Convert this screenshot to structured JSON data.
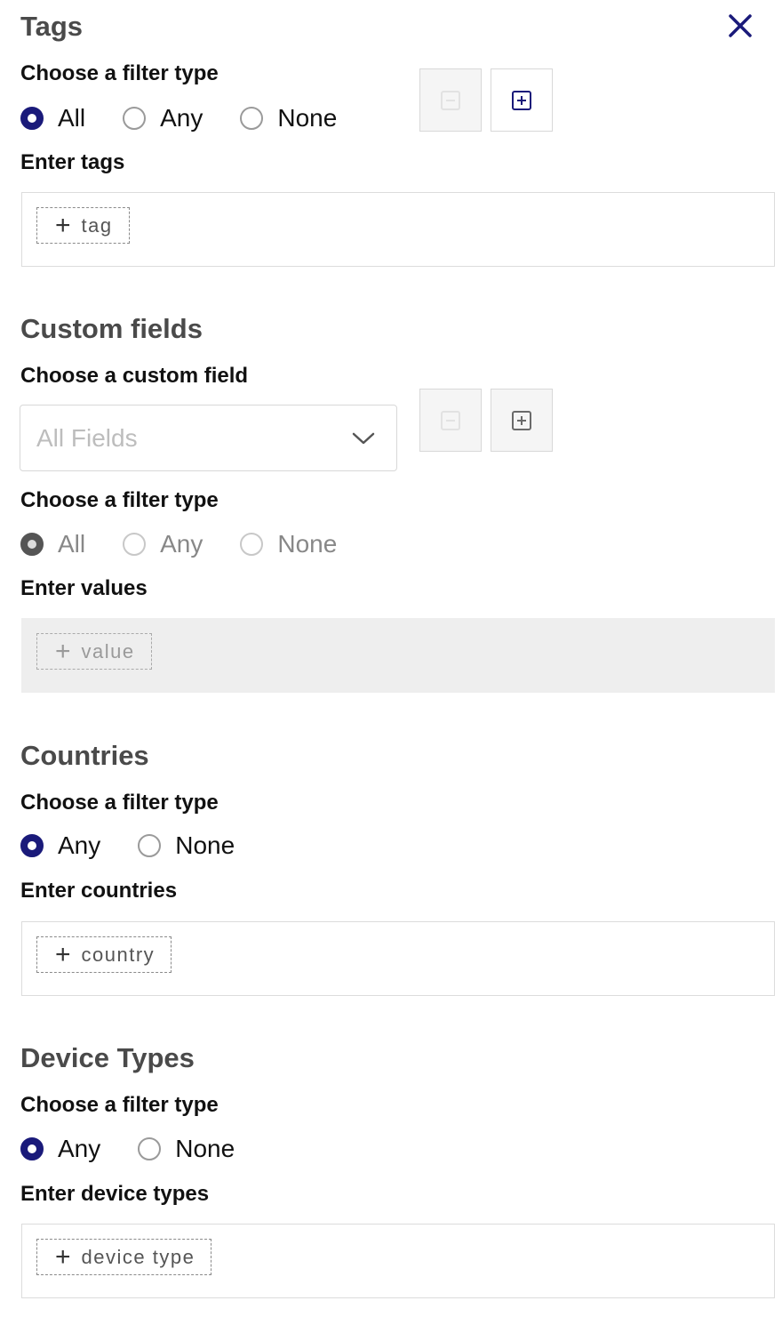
{
  "colors": {
    "accent": "#1a1a7a",
    "section_title": "#4a4a4a",
    "disabled_fill": "#eeeeee"
  },
  "close_icon": "close-icon",
  "tags": {
    "title": "Tags",
    "filter_label": "Choose a filter type",
    "options": [
      "All",
      "Any",
      "None"
    ],
    "selected": "All",
    "input_label": "Enter tags",
    "add_chip": "tag"
  },
  "custom_fields": {
    "title": "Custom fields",
    "field_label": "Choose a custom field",
    "field_select_value": "All Fields",
    "filter_label": "Choose a filter type",
    "options": [
      "All",
      "Any",
      "None"
    ],
    "selected": "All",
    "input_label": "Enter values",
    "add_chip": "value"
  },
  "countries": {
    "title": "Countries",
    "filter_label": "Choose a filter type",
    "options": [
      "Any",
      "None"
    ],
    "selected": "Any",
    "input_label": "Enter countries",
    "add_chip": "country"
  },
  "device_types": {
    "title": "Device Types",
    "filter_label": "Choose a filter type",
    "options": [
      "Any",
      "None"
    ],
    "selected": "Any",
    "input_label": "Enter device types",
    "add_chip": "device type"
  }
}
